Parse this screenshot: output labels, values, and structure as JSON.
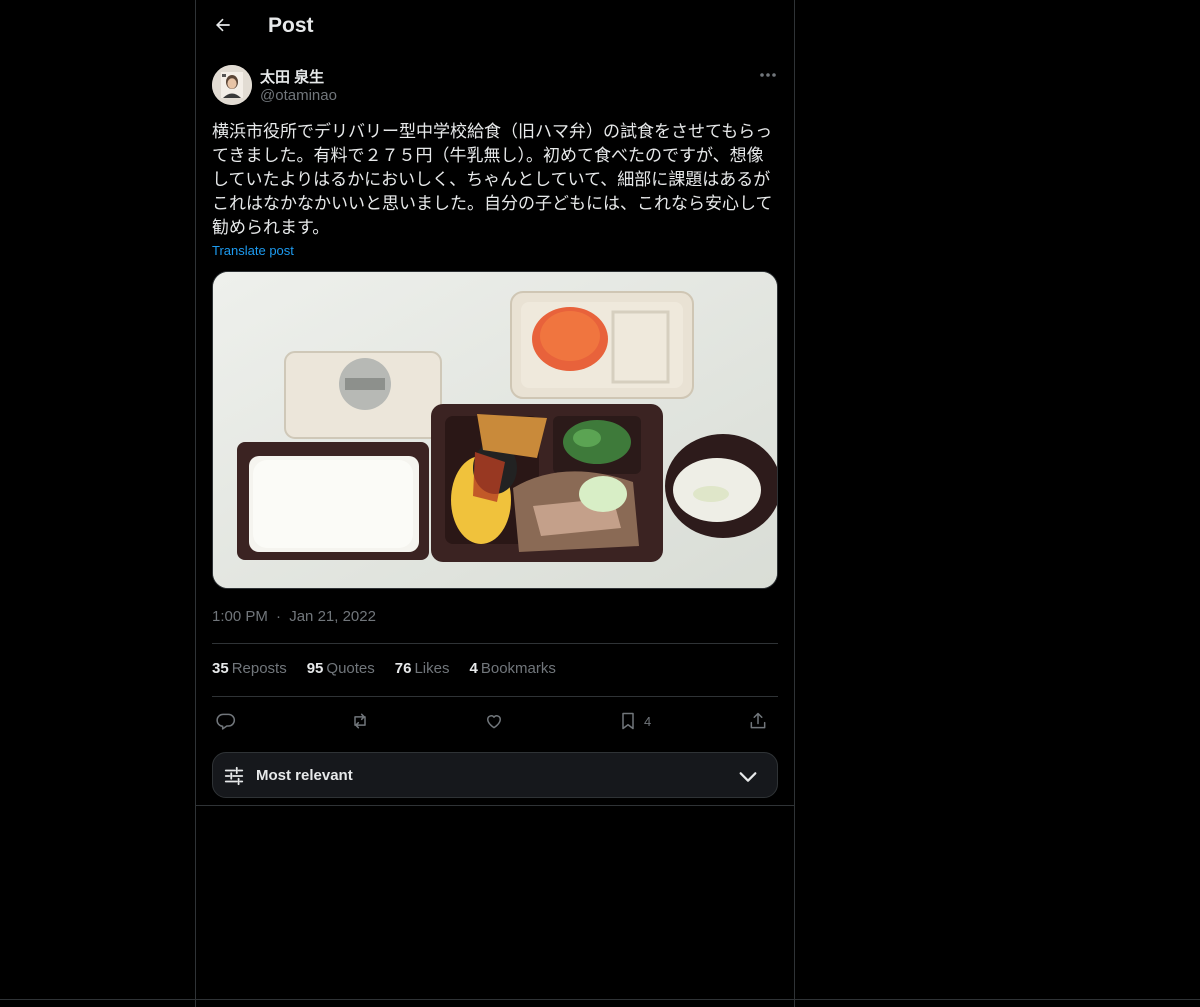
{
  "header": {
    "title": "Post",
    "back_icon": "arrow-left-icon"
  },
  "author": {
    "name": "太田 泉生",
    "handle": "@otaminao",
    "avatar_icon": "avatar-portrait"
  },
  "post": {
    "text": "横浜市役所でデリバリー型中学校給食（旧ハマ弁）の試食をさせてもらってきました。有料で２７５円（牛乳無し）。初めて食べたのですが、想像していたよりはるかにおいしく、ちゃんとしていて、細部に課題はあるがこれはなかなかいいと思いました。自分の子どもには、これなら安心して勧められます。",
    "translate_label": "Translate post",
    "time": "1:00 PM",
    "separator": "·",
    "date": "Jan 21, 2022"
  },
  "stats": {
    "reposts_count": "35",
    "reposts_label": "Reposts",
    "quotes_count": "95",
    "quotes_label": "Quotes",
    "likes_count": "76",
    "likes_label": "Likes",
    "bookmarks_count": "4",
    "bookmarks_label": "Bookmarks"
  },
  "actions": {
    "reply_icon": "reply-icon",
    "repost_icon": "repost-icon",
    "like_icon": "heart-icon",
    "bookmark_icon": "bookmark-icon",
    "bookmark_count": "4",
    "share_icon": "share-icon"
  },
  "sort": {
    "label": "Most relevant",
    "icon": "sliders-icon",
    "chevron": "chevron-down-icon"
  },
  "colors": {
    "background": "#000000",
    "text": "#e7e9ea",
    "muted": "#71767b",
    "link": "#1d9bf0",
    "border": "#2f3336"
  }
}
